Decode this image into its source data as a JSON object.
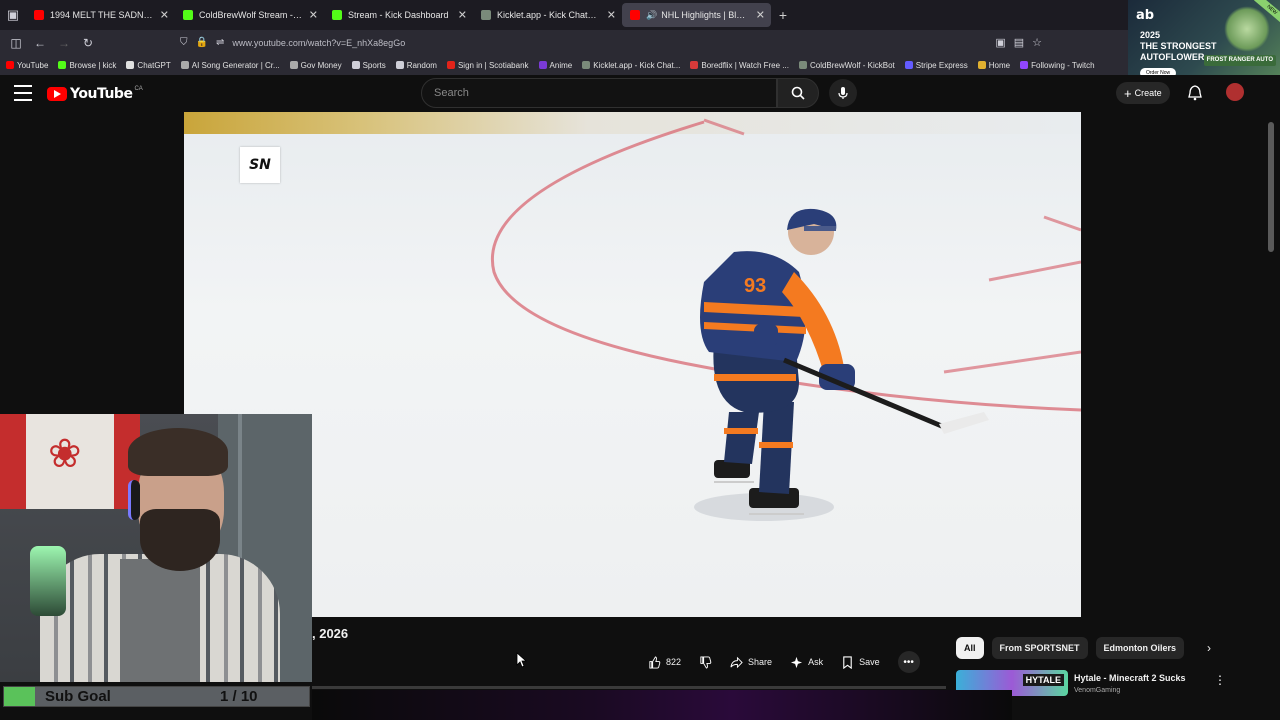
{
  "browser": {
    "tabs": [
      {
        "label": "1994 MELT THE SADNESS // D",
        "color": "#ff0000"
      },
      {
        "label": "ColdBrewWolf Stream - Watch",
        "color": "#53fc18"
      },
      {
        "label": "Stream - Kick Dashboard",
        "color": "#53fc18"
      },
      {
        "label": "Kicklet.app - Kick Chatbot and",
        "color": "#7a8a7a"
      },
      {
        "label": "NHL Highlights | Blues vs. C",
        "color": "#ff0000"
      }
    ],
    "url": "www.youtube.com/watch?v=E_nhXa8egGo",
    "bookmarks": [
      {
        "label": "YouTube",
        "color": "#ff0000"
      },
      {
        "label": "Browse | kick",
        "color": "#53fc18"
      },
      {
        "label": "ChatGPT",
        "color": "#e0e0e0"
      },
      {
        "label": "AI Song Generator | Cr...",
        "color": "#aaaaaa"
      },
      {
        "label": "Gov Money",
        "color": "#aaaaaa"
      },
      {
        "label": "Sports",
        "color": "#cfcfd8"
      },
      {
        "label": "Random",
        "color": "#cfcfd8"
      },
      {
        "label": "Sign in | Scotiabank",
        "color": "#e2231a"
      },
      {
        "label": "Anime",
        "color": "#7a3ad6"
      },
      {
        "label": "Kicklet.app - Kick Chat...",
        "color": "#7a8a7a"
      },
      {
        "label": "Boredflix | Watch Free ...",
        "color": "#d63a3a"
      },
      {
        "label": "ColdBrewWolf - KickBot",
        "color": "#7a8a7a"
      },
      {
        "label": "Stripe Express",
        "color": "#635bff"
      },
      {
        "label": "Home",
        "color": "#e0b030"
      },
      {
        "label": "Following - Twitch",
        "color": "#9146ff"
      }
    ]
  },
  "ad": {
    "logo": "ab",
    "line1": "2025",
    "line2": "THE STRONGEST",
    "line3": "AUTOFLOWER",
    "button": "Order Now",
    "strain": "FROST RANGER AUTO",
    "ribbon": "NEW"
  },
  "youtube": {
    "wordmark": "YouTube",
    "region": "CA",
    "search_placeholder": "Search",
    "create_label": "Create"
  },
  "video": {
    "network_bug": "SN",
    "date_fragment": ", 2026",
    "likes": "822",
    "share_label": "Share",
    "ask_label": "Ask",
    "save_label": "Save"
  },
  "chips": [
    "All",
    "From SPORTSNET",
    "Edmonton Oilers"
  ],
  "recommendation": {
    "title": "Hytale - Minecraft 2 Sucks",
    "channel": "VenomGaming",
    "thumb_text": "HYTALE"
  },
  "stream_overlay": {
    "label": "Sub Goal",
    "count": "1 / 10",
    "progress": 0.1
  }
}
